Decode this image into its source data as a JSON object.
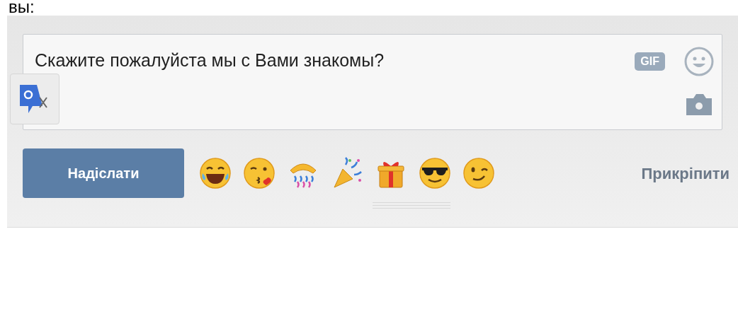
{
  "heading": "вы:",
  "message_field": {
    "value": "Скажите пожалуйста мы с Вами знакомы?",
    "gif_label": "GIF"
  },
  "send_button": "Надіслати",
  "attach_link": "Прикріпити"
}
